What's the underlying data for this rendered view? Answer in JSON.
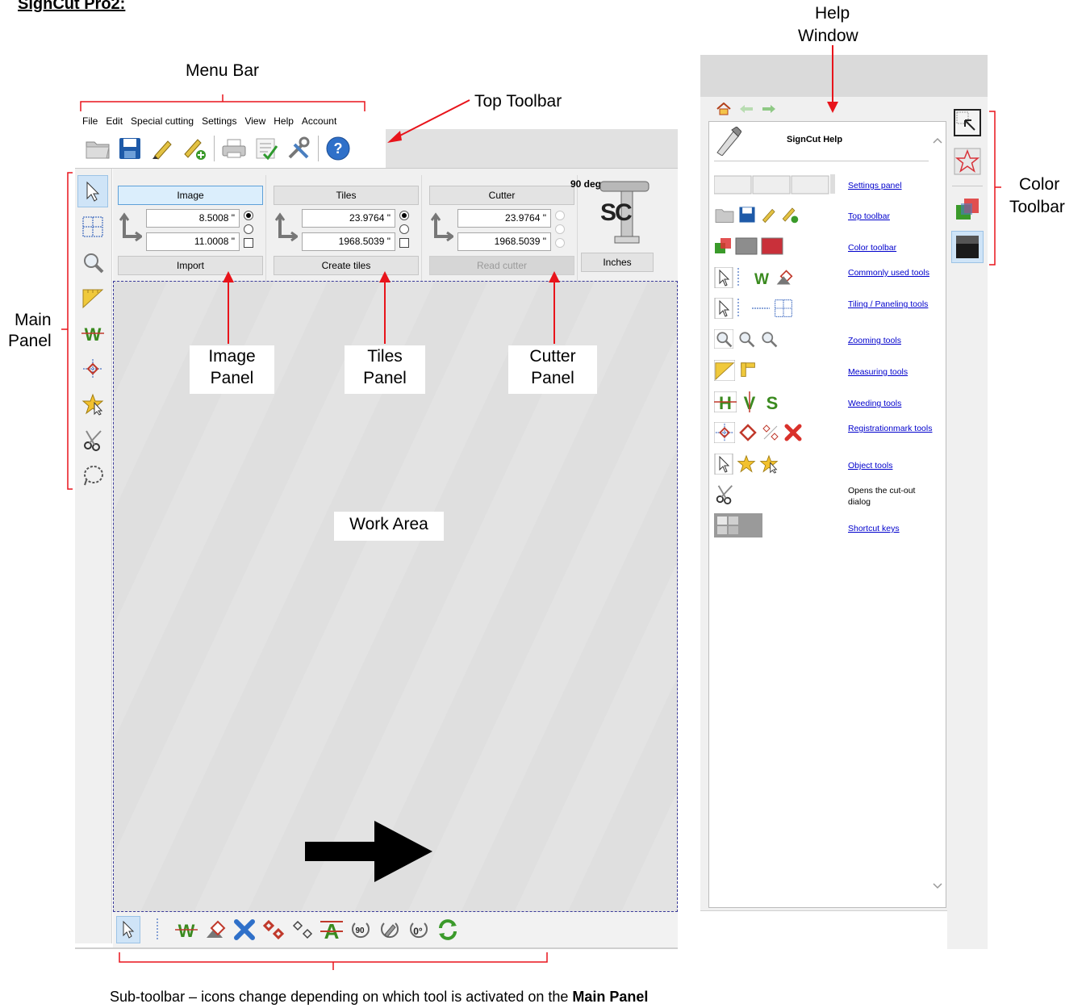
{
  "page_title": "SignCut Pro2:",
  "menu": [
    "File",
    "Edit",
    "Special cutting",
    "Settings",
    "View",
    "Help",
    "Account"
  ],
  "callouts": {
    "menu_bar": "Menu Bar",
    "top_toolbar": "Top Toolbar",
    "help_window_line1": "Help",
    "help_window_line2": "Window",
    "main_panel_line1": "Main",
    "main_panel_line2": "Panel",
    "color_toolbar_line1": "Color",
    "color_toolbar_line2": "Toolbar",
    "image_panel_line1": "Image",
    "image_panel_line2": "Panel",
    "tiles_panel_line1": "Tiles",
    "tiles_panel_line2": "Panel",
    "cutter_panel_line1": "Cutter",
    "cutter_panel_line2": "Panel",
    "work_area": "Work Area",
    "sub_toolbar_caption": "Sub-toolbar – icons change depending on which tool is activated on the ",
    "sub_toolbar_caption_bold": "Main Panel"
  },
  "image_panel": {
    "title": "Image",
    "x_value": "8.5008 \"",
    "y_value": "11.0008 \"",
    "button": "Import"
  },
  "tiles_panel": {
    "title": "Tiles",
    "x_value": "23.9764 \"",
    "y_value": "1968.5039 \"",
    "button": "Create tiles"
  },
  "cutter_panel": {
    "title": "Cutter",
    "x_value": "23.9764 \"",
    "y_value": "1968.5039 \"",
    "button": "Read cutter"
  },
  "rotation_label": "90 deg",
  "units_button": "Inches",
  "cutter_logo_text": "SC",
  "help": {
    "title": "SignCut Help",
    "entries": [
      {
        "label": "Settings panel",
        "link": true
      },
      {
        "label": "Top toolbar",
        "link": true
      },
      {
        "label": "Color toolbar",
        "link": true
      },
      {
        "label": "Commonly used tools",
        "link": true
      },
      {
        "label": "Tiling / Paneling tools",
        "link": true
      },
      {
        "label": "Zooming tools",
        "link": true
      },
      {
        "label": "Measuring tools",
        "link": true
      },
      {
        "label": "Weeding tools",
        "link": true
      },
      {
        "label": "Registrationmark tools",
        "link": true
      },
      {
        "label": "Object tools",
        "link": true
      },
      {
        "label": "Opens the cut-out dialog",
        "link": false
      },
      {
        "label": "Shortcut keys",
        "link": true
      }
    ]
  },
  "colors": {
    "accent_red": "#e8141b",
    "link_blue": "#0000cc",
    "weed_green": "#3a8a1f"
  }
}
